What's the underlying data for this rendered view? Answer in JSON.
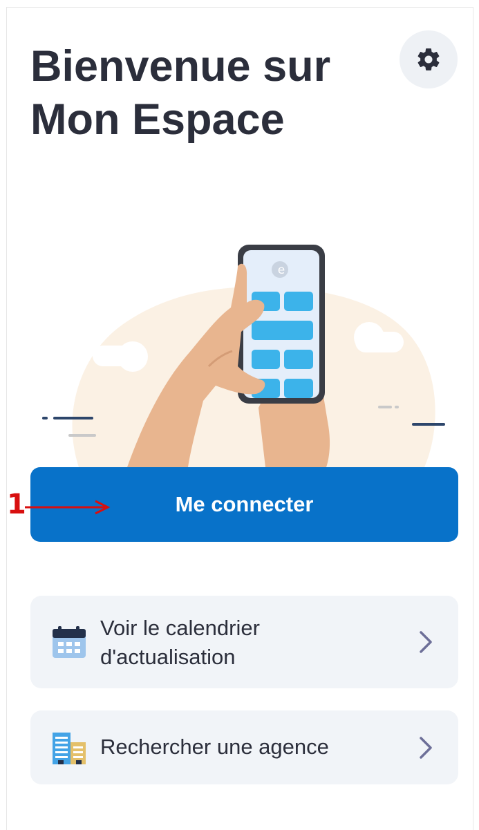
{
  "header": {
    "title_line1": "Bienvenue sur",
    "title_line2": "Mon Espace"
  },
  "settings": {
    "icon": "gear-icon"
  },
  "illustration": {
    "icon": "phone-in-hands-illustration",
    "phone_logo": "e"
  },
  "connect_button": {
    "label": "Me connecter"
  },
  "annotation": {
    "number": "1"
  },
  "cards": [
    {
      "label_line1": "Voir le calendrier",
      "label_line2": "d'actualisation",
      "icon": "calendar-icon"
    },
    {
      "label": "Rechercher une agence",
      "icon": "building-icon"
    }
  ],
  "colors": {
    "primary": "#0872c9",
    "title_text": "#2b2e3b",
    "card_bg": "#f1f4f8",
    "annotation": "#d80f0f",
    "chevron": "#6d6f98"
  }
}
